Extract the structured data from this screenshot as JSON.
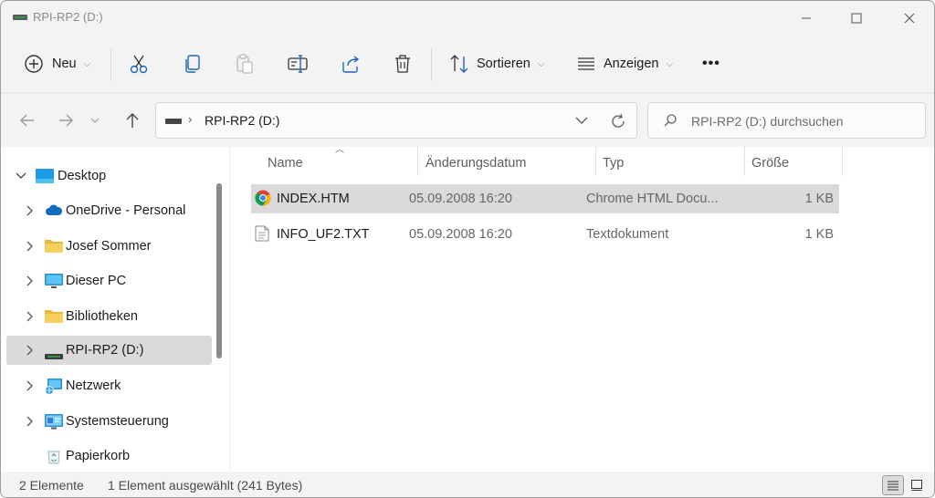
{
  "window": {
    "title": "RPI-RP2 (D:)"
  },
  "toolbar": {
    "new_label": "Neu",
    "sort_label": "Sortieren",
    "view_label": "Anzeigen",
    "more_label": "•••"
  },
  "address": {
    "path": "RPI-RP2 (D:)",
    "separator": "›"
  },
  "search": {
    "placeholder": "RPI-RP2 (D:) durchsuchen"
  },
  "sidebar": {
    "items": [
      {
        "label": "Desktop",
        "icon": "desktop-icon",
        "expanded": true
      },
      {
        "label": "OneDrive - Personal",
        "icon": "cloud-icon"
      },
      {
        "label": "Josef Sommer",
        "icon": "folder-icon"
      },
      {
        "label": "Dieser PC",
        "icon": "monitor-icon"
      },
      {
        "label": "Bibliotheken",
        "icon": "folder-icon"
      },
      {
        "label": "RPI-RP2 (D:)",
        "icon": "drive-icon",
        "selected": true
      },
      {
        "label": "Netzwerk",
        "icon": "network-icon"
      },
      {
        "label": "Systemsteuerung",
        "icon": "control-panel-icon"
      },
      {
        "label": "Papierkorb",
        "icon": "recycle-bin-icon"
      }
    ]
  },
  "filelist": {
    "columns": {
      "name": "Name",
      "date": "Änderungsdatum",
      "type": "Typ",
      "size": "Größe"
    },
    "files": [
      {
        "name": "INDEX.HTM",
        "date": "05.09.2008 16:20",
        "type": "Chrome HTML Docu...",
        "size": "1 KB",
        "icon": "chrome-icon",
        "selected": true
      },
      {
        "name": "INFO_UF2.TXT",
        "date": "05.09.2008 16:20",
        "type": "Textdokument",
        "size": "1 KB",
        "icon": "text-file-icon"
      }
    ]
  },
  "status": {
    "count": "2 Elemente",
    "selection": "1 Element ausgewählt (241 Bytes)"
  },
  "colors": {
    "selection": "#dadada",
    "accent_blue": "#0078d4",
    "folder_yellow": "#f2c94c"
  }
}
